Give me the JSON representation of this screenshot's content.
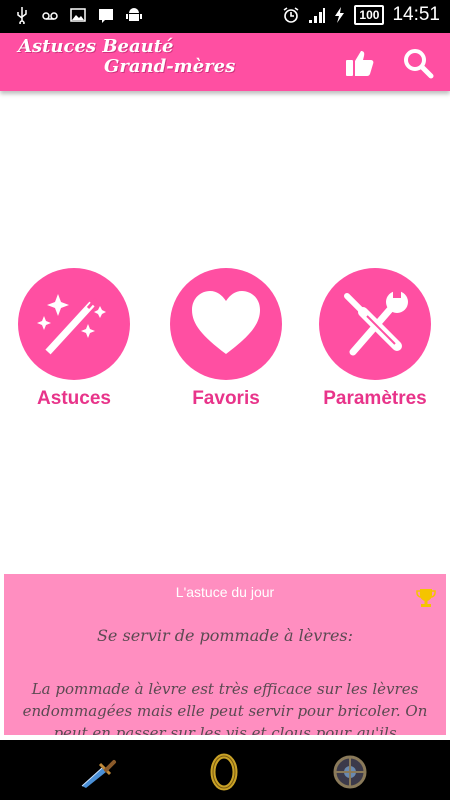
{
  "status_bar": {
    "left_icons": [
      "usb-icon",
      "voicemail-icon",
      "image-icon",
      "notification-icon",
      "android-icon"
    ],
    "right_icons": [
      "alarm-icon",
      "signal-icon",
      "charging-icon"
    ],
    "battery": "100",
    "time": "14:51"
  },
  "app_bar": {
    "title_line1": "Astuces Beauté",
    "title_line2": "Grand-mères",
    "actions": [
      "thumbs-up-icon",
      "search-icon"
    ],
    "color": "#ff4fa2"
  },
  "tiles": [
    {
      "label": "Astuces",
      "icon": "magic-wand-icon"
    },
    {
      "label": "Favoris",
      "icon": "heart-icon"
    },
    {
      "label": "Paramètres",
      "icon": "tools-icon"
    }
  ],
  "tip_of_day": {
    "header": "L'astuce du jour",
    "title": "Se servir de pommade à lèvres:",
    "body": "La pommade à lèvre est très efficace sur les lèvres endommagées mais elle peut servir pour bricoler. On peut en passer sur les vis et clous pour qu'ils",
    "icon": "trophy-icon",
    "background": "#ff8ec0"
  },
  "bottom_bar": {
    "items": [
      "dagger-icon",
      "ring-icon",
      "shield-icon"
    ]
  },
  "colors": {
    "accent": "#ff4fa2",
    "label": "#e8348a"
  }
}
